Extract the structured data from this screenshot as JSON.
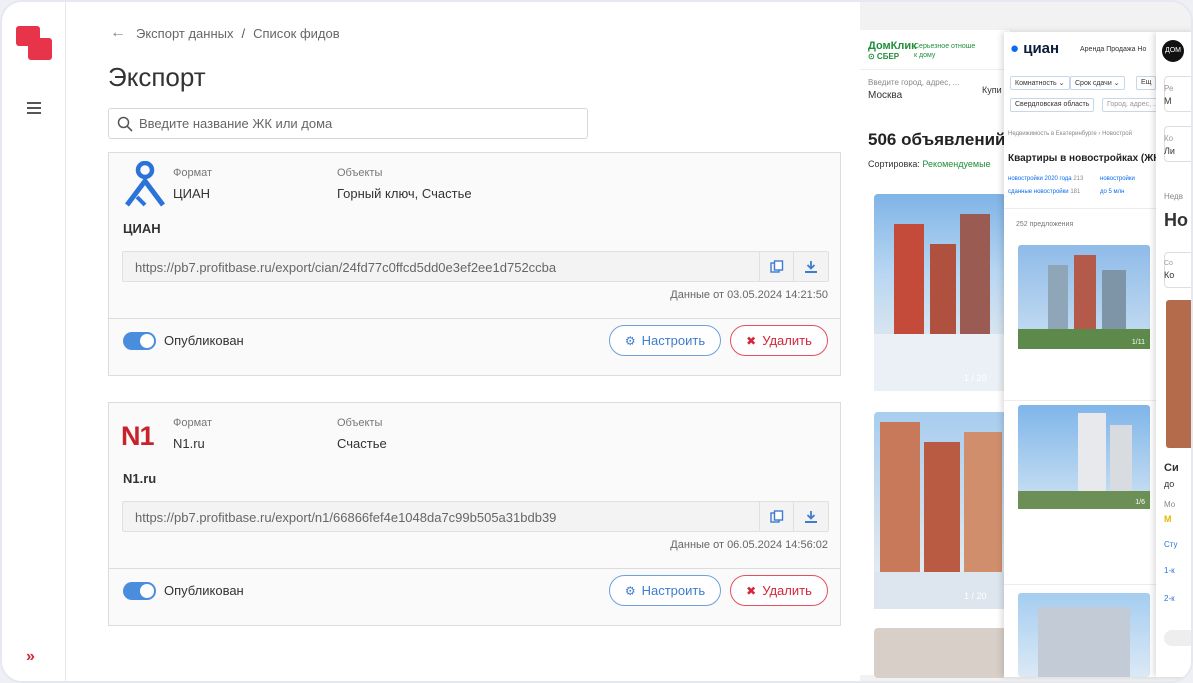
{
  "sidebar": {
    "expand_glyph": "»"
  },
  "breadcrumb": {
    "back_glyph": "←",
    "parent": "Экспорт данных",
    "separator": "/",
    "current": "Список фидов"
  },
  "page": {
    "title": "Экспорт"
  },
  "search": {
    "placeholder": "Введите название ЖК или дома"
  },
  "labels": {
    "format": "Формат",
    "objects": "Объекты",
    "published": "Опубликован",
    "configure": "Настроить",
    "delete": "Удалить",
    "configure_glyph": "⚙",
    "delete_glyph": "✖"
  },
  "feeds": [
    {
      "format": "ЦИАН",
      "objects": "Горный ключ, Счастье",
      "name": "ЦИАН",
      "url": "https://pb7.profitbase.ru/export/cian/24fd77c0ffcd5dd0e3ef2ee1d752ccba",
      "date": "Данные от 03.05.2024 14:21:50",
      "published": true
    },
    {
      "format": "N1.ru",
      "objects": "Счастье",
      "name": "N1.ru",
      "url": "https://pb7.profitbase.ru/export/n1/66866fef4e1048da7c99b505a31bdb39",
      "date": "Данные от 06.05.2024 14:56:02",
      "published": true,
      "logo_text": "N1"
    }
  ],
  "preview_domclick": {
    "brand": "ДомКлик",
    "sub": "⊙ СБЕР",
    "slogan_1": "Серьезное отноше",
    "slogan_2": "к дому",
    "city_label": "Введите город, адрес, ...",
    "city_value": "Москва",
    "buy": "Купи",
    "count": "506 объявлений н",
    "sort_label": "Сортировка:",
    "sort_value": "Рекомендуемые",
    "photo_counter_1": "1 / 20",
    "photo_counter_2": "1 / 20"
  },
  "preview_cian": {
    "brand": "циан",
    "nav": "Аренда   Продажа   Но",
    "chip_1": "Комнатность ⌄",
    "chip_2": "Срок сдачи ⌄",
    "chip_3": "Ещ",
    "chip_4": "Свердловская область",
    "chip_5": "Город, адрес, ...",
    "breadcrumb": "Недвижимость в Екатеринбурге  ›  Новострой",
    "title": "Квартиры в новостройках (ЖК",
    "link_1": "новостройки 2020 года",
    "link_1_count": "213",
    "link_2": "сданные новостройки",
    "link_2_count": "181",
    "link_3": "новостройки",
    "link_4": "до 5 млн",
    "offers": "252 предложения",
    "photo_counter_1": "1/11",
    "photo_counter_2": "1/6"
  },
  "preview_third": {
    "logo": "ДОМ",
    "t1": "Ре",
    "t2": "М",
    "t3": "Ко",
    "t4": "Ли",
    "t5": "Недв",
    "t6": "Но",
    "t7": "Со",
    "t8": "Ко",
    "t9": "Си",
    "t10": "до",
    "t11": "Мо",
    "t12": "М",
    "t13": "Сту",
    "t14": "1-к",
    "t15": "2-к"
  }
}
